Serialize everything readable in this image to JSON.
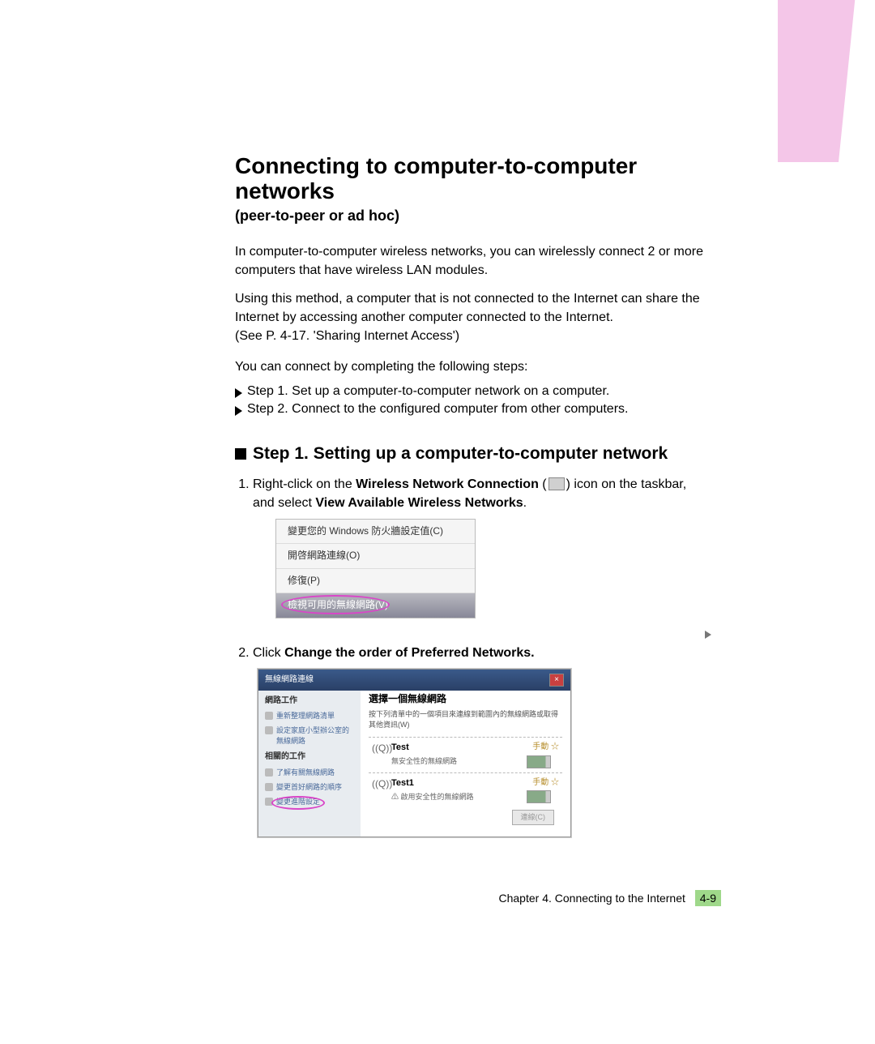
{
  "heading": "Connecting to computer-to-computer networks",
  "subtitle": "(peer-to-peer or ad hoc)",
  "p1": "In computer-to-computer wireless networks, you can wirelessly connect 2 or more computers that have wireless LAN modules.",
  "p2a": "Using this method, a computer that is not connected to the Internet can share the Internet by accessing another computer connected to the Internet.",
  "p2b": "(See P. 4-17. 'Sharing Internet Access')",
  "p3": "You can connect by completing the following steps:",
  "arrow_step1": "Step 1. Set up a computer-to-computer network on a computer.",
  "arrow_step2": "Step 2. Connect to the configured computer from other computers.",
  "h2_step1": "Step 1. Setting up a computer-to-computer network",
  "li1_a": "Right-click on the ",
  "li1_b": "Wireless Network Connection",
  "li1_c": " (",
  "li1_d": ") icon on the taskbar, and select ",
  "li1_e": "View Available Wireless Networks",
  "li1_f": ".",
  "li2_a": "Click ",
  "li2_b": "Change the order of Preferred Networks.",
  "menu": {
    "item1": "變更您的 Windows 防火牆設定值(C)",
    "item2": "開啓網路連線(O)",
    "item3": "修復(P)",
    "item4": "檢視可用的無線網路(V)"
  },
  "wifi_dialog": {
    "title": "無線網路連線",
    "left_header1": "網路工作",
    "left_task1": "重新整理網路清單",
    "left_task2": "設定家庭小型辦公室的無線網路",
    "left_header2": "相關的工作",
    "left_task3": "了解有關無線網路",
    "left_task4": "變更首好網路的順序",
    "left_task5": "變更進階設定",
    "panel_title": "選擇一個無線網路",
    "panel_sub": "按下列清單中的一個項目來連線到範圍內的無線網路或取得其他資訊(W)",
    "net1_name": "Test",
    "net1_desc": "無安全性的無線網路",
    "net1_star": "手動 ☆",
    "net2_name": "Test1",
    "net2_desc": "⚠ 啟用安全性的無線網路",
    "net2_star": "手動 ☆",
    "connect_btn": "連線(C)"
  },
  "footer_chapter": "Chapter 4. Connecting to the Internet",
  "footer_page": "4-9"
}
